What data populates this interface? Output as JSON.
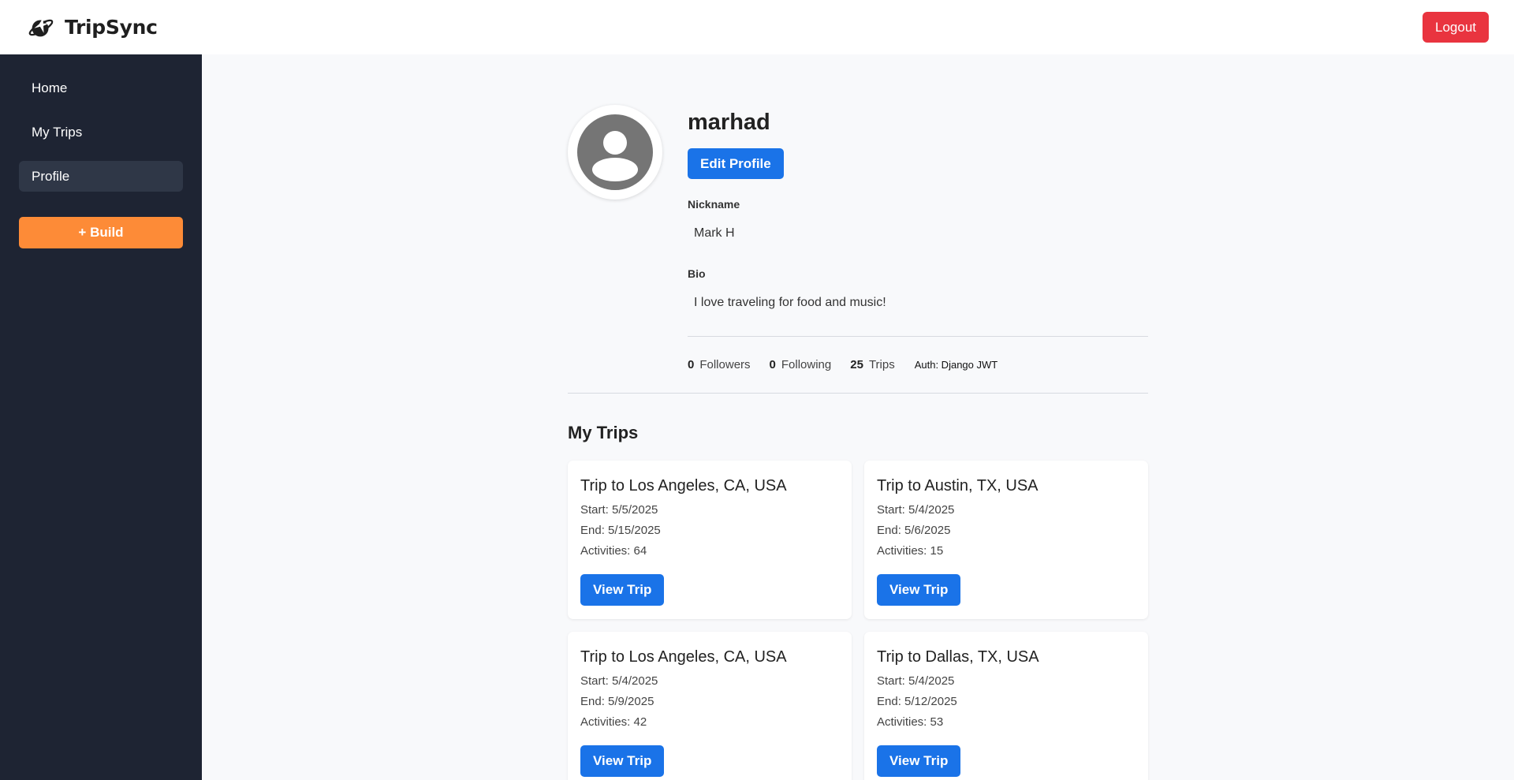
{
  "header": {
    "app_name": "TripSync",
    "logo_icon": "planet-plane-icon",
    "logout_label": "Logout"
  },
  "sidebar": {
    "items": [
      {
        "label": "Home",
        "active": false
      },
      {
        "label": "My Trips",
        "active": false
      },
      {
        "label": "Profile",
        "active": true
      }
    ],
    "build_label": "+ Build"
  },
  "profile": {
    "avatar_icon": "user-avatar-icon",
    "username": "marhad",
    "edit_label": "Edit Profile",
    "nickname_label": "Nickname",
    "nickname": "Mark H",
    "bio_label": "Bio",
    "bio": "I love traveling for food and music!",
    "stats": {
      "followers_count": "0",
      "followers_label": "Followers",
      "following_count": "0",
      "following_label": "Following",
      "trips_count": "25",
      "trips_label": "Trips",
      "auth": "Auth: Django JWT"
    }
  },
  "trips": {
    "title": "My Trips",
    "button_label": "View Trip",
    "items": [
      {
        "title": "Trip to Los Angeles, CA, USA",
        "start": "Start: 5/5/2025",
        "end": "End: 5/15/2025",
        "activities": "Activities: 64"
      },
      {
        "title": "Trip to Austin, TX, USA",
        "start": "Start: 5/4/2025",
        "end": "End: 5/6/2025",
        "activities": "Activities: 15"
      },
      {
        "title": "Trip to Los Angeles, CA, USA",
        "start": "Start: 5/4/2025",
        "end": "End: 5/9/2025",
        "activities": "Activities: 42"
      },
      {
        "title": "Trip to Dallas, TX, USA",
        "start": "Start: 5/4/2025",
        "end": "End: 5/12/2025",
        "activities": "Activities: 53"
      }
    ]
  },
  "colors": {
    "primary": "#1a73e8",
    "danger": "#e9343f",
    "build": "#fd8b37",
    "sidebar_bg": "#1e2433"
  }
}
